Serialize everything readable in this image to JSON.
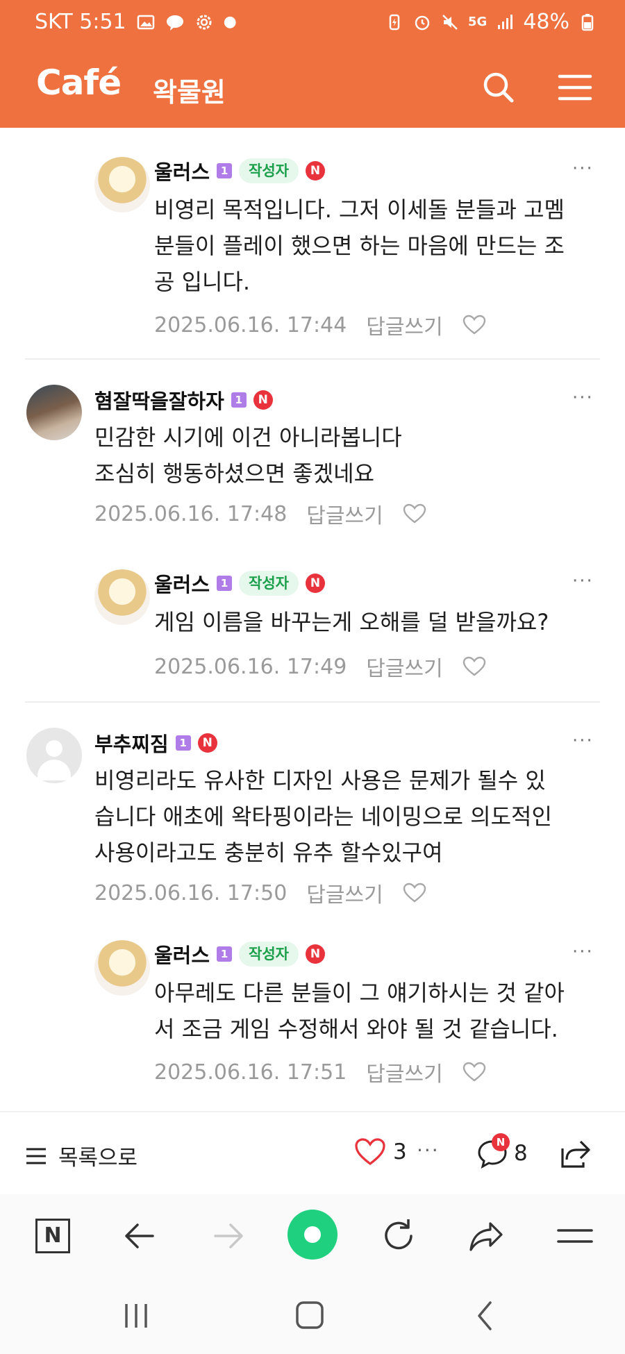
{
  "status_bar": {
    "carrier_time": "SKT 5:51",
    "battery": "48%",
    "network": "5G"
  },
  "header": {
    "logo": "Café",
    "cafe_name": "왁물원",
    "icons": [
      "search-icon",
      "hamburger-menu-icon"
    ]
  },
  "comments": [
    {
      "author": "울러스",
      "level": "1",
      "writer_badge": "작성자",
      "n_badge": "N",
      "text": "비영리 목적입니다. 그저 이세돌 분들과 고멤\n분들이 플레이 했으면 하는 마음에 만드는 조\n공 입니다.",
      "date": "2025.06.16. 17:44",
      "reply_label": "답글쓰기",
      "is_reply": true
    },
    {
      "author": "혐잘딱을잘하자",
      "level": "1",
      "writer_badge": "",
      "n_badge": "N",
      "text": "민감한 시기에 이건 아니라봅니다\n조심히 행동하셨으면 좋겠네요",
      "date": "2025.06.16. 17:48",
      "reply_label": "답글쓰기",
      "is_reply": false
    },
    {
      "author": "울러스",
      "level": "1",
      "writer_badge": "작성자",
      "n_badge": "N",
      "text": "게임 이름을 바꾸는게 오해를 덜 받을까요?",
      "date": "2025.06.16. 17:49",
      "reply_label": "답글쓰기",
      "is_reply": true
    },
    {
      "author": "부추찌짐",
      "level": "1",
      "writer_badge": "",
      "n_badge": "N",
      "text": "비영리라도 유사한 디자인 사용은 문제가 될수 있\n습니다 애초에 왁타핑이라는 네이밍으로 의도적인\n사용이라고도 충분히 유추 할수있구여",
      "date": "2025.06.16. 17:50",
      "reply_label": "답글쓰기",
      "is_reply": false
    },
    {
      "author": "울러스",
      "level": "1",
      "writer_badge": "작성자",
      "n_badge": "N",
      "text": "아무레도 다른 분들이 그 얘기하시는 것 같아\n서 조금 게임 수정해서 와야 될 것 같습니다.",
      "date": "2025.06.16. 17:51",
      "reply_label": "답글쓰기",
      "is_reply": true
    }
  ],
  "more_label": "···",
  "action_bar": {
    "list_label": "목록으로",
    "like_count": "3",
    "more": "···",
    "comment_count": "8",
    "comment_badge": "N"
  },
  "browser_bar": {
    "naver_label": "N"
  },
  "colors": {
    "brand": "#ee713f",
    "writer_badge_bg": "#e6f7ec",
    "writer_badge_text": "#1ca04b",
    "n_badge": "#e8323c",
    "level_badge": "#b07de8",
    "green_home": "#1fd07f"
  }
}
